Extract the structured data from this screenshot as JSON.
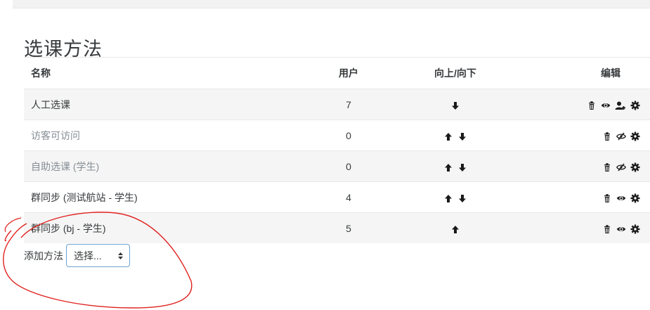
{
  "page_title": "选课方法",
  "table": {
    "headers": {
      "name": "名称",
      "users": "用户",
      "updown": "向上/向下",
      "edit": "编辑"
    },
    "rows": [
      {
        "name": "人工选课",
        "users": "7",
        "arrows": [
          "down"
        ],
        "edit_icons": [
          "trash-icon",
          "eye-icon",
          "add-user-icon",
          "gear-icon"
        ],
        "dimmed": false
      },
      {
        "name": "访客可访问",
        "users": "0",
        "arrows": [
          "up",
          "down"
        ],
        "edit_icons": [
          "trash-icon",
          "eye-slash-icon",
          "gear-icon"
        ],
        "dimmed": true
      },
      {
        "name": "自助选课 (学生)",
        "users": "0",
        "arrows": [
          "up",
          "down"
        ],
        "edit_icons": [
          "trash-icon",
          "eye-slash-icon",
          "gear-icon"
        ],
        "dimmed": true
      },
      {
        "name": "群同步 (测试航站 - 学生)",
        "users": "4",
        "arrows": [
          "up",
          "down"
        ],
        "edit_icons": [
          "trash-icon",
          "eye-icon",
          "gear-icon"
        ],
        "dimmed": false
      },
      {
        "name": "群同步 (bj - 学生)",
        "users": "5",
        "arrows": [
          "up"
        ],
        "edit_icons": [
          "trash-icon",
          "eye-icon",
          "gear-icon"
        ],
        "dimmed": false
      }
    ]
  },
  "add_method": {
    "label": "添加方法",
    "select_value": "选择..."
  },
  "colors": {
    "select_border": "#6ea2d6",
    "annotation": "#e0221f"
  }
}
